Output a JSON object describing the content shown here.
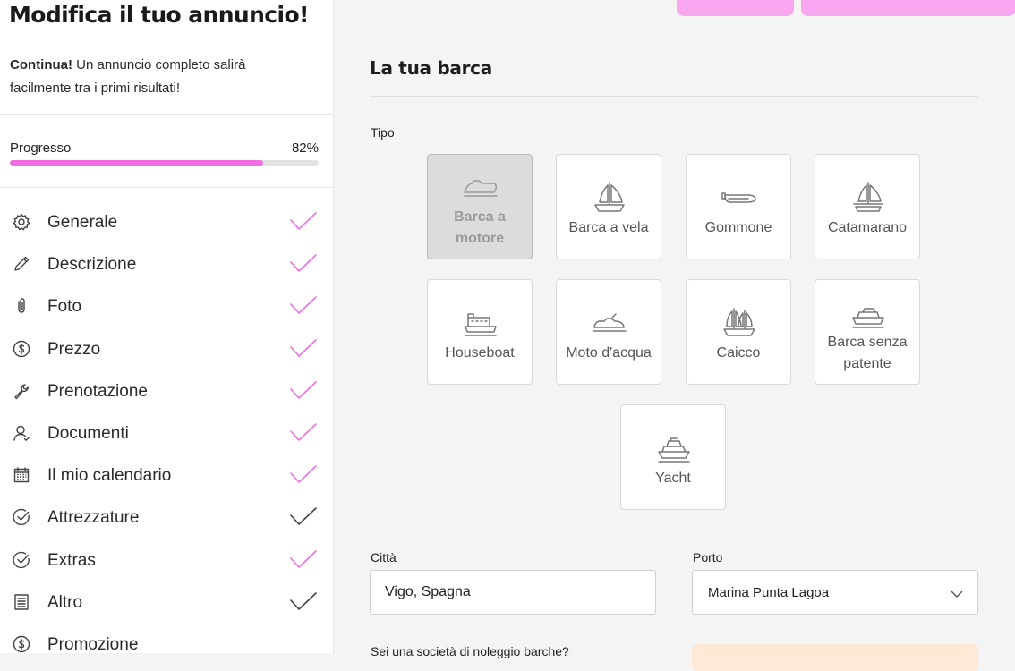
{
  "sidebar": {
    "title": "Modifica il tuo annuncio!",
    "subtitle_bold": "Continua!",
    "subtitle_rest": " Un annuncio completo salirà facilmente tra i primi risultati!",
    "progress": {
      "label": "Progresso",
      "value_text": "82%",
      "value": 82,
      "color": "#f06de3"
    },
    "items": [
      {
        "label": "Generale",
        "icon": "gear-icon",
        "check_color": "#f06de3"
      },
      {
        "label": "Descrizione",
        "icon": "pencil-icon",
        "check_color": "#f06de3"
      },
      {
        "label": "Foto",
        "icon": "paperclip-icon",
        "check_color": "#f06de3"
      },
      {
        "label": "Prezzo",
        "icon": "dollar-icon",
        "check_color": "#f06de3"
      },
      {
        "label": "Prenotazione",
        "icon": "wrench-icon",
        "check_color": "#f06de3"
      },
      {
        "label": "Documenti",
        "icon": "user-icon",
        "check_color": "#f06de3"
      },
      {
        "label": "Il mio calendario",
        "icon": "calendar-icon",
        "check_color": "#f06de3"
      },
      {
        "label": "Attrezzature",
        "icon": "check-circle-icon",
        "check_color": "#444444"
      },
      {
        "label": "Extras",
        "icon": "check-circle-icon",
        "check_color": "#f06de3"
      },
      {
        "label": "Altro",
        "icon": "list-icon",
        "check_color": "#444444"
      },
      {
        "label": "Promozione",
        "icon": "dollar-icon",
        "check_color": ""
      }
    ]
  },
  "main": {
    "section_title": "La tua barca",
    "type_label": "Tipo",
    "boat_types": [
      {
        "label": "Barca a motore",
        "icon": "motorboat-icon",
        "selected": true
      },
      {
        "label": "Barca a vela",
        "icon": "sailboat-icon",
        "selected": false
      },
      {
        "label": "Gommone",
        "icon": "dinghy-icon",
        "selected": false
      },
      {
        "label": "Catamarano",
        "icon": "catamaran-icon",
        "selected": false
      },
      {
        "label": "Houseboat",
        "icon": "houseboat-icon",
        "selected": false
      },
      {
        "label": "Moto d'acqua",
        "icon": "jetski-icon",
        "selected": false
      },
      {
        "label": "Caicco",
        "icon": "gulet-icon",
        "selected": false
      },
      {
        "label": "Barca senza patente",
        "icon": "boat-icon",
        "selected": false
      },
      {
        "label": "Yacht",
        "icon": "yacht-icon",
        "selected": false
      }
    ],
    "city": {
      "label": "Città",
      "value": "Vigo, Spagna"
    },
    "port": {
      "label": "Porto",
      "value": "Marina Punta Lagoa"
    },
    "company_question": "Sei una società di noleggio barche?",
    "accent_color": "#f9a6f0"
  }
}
